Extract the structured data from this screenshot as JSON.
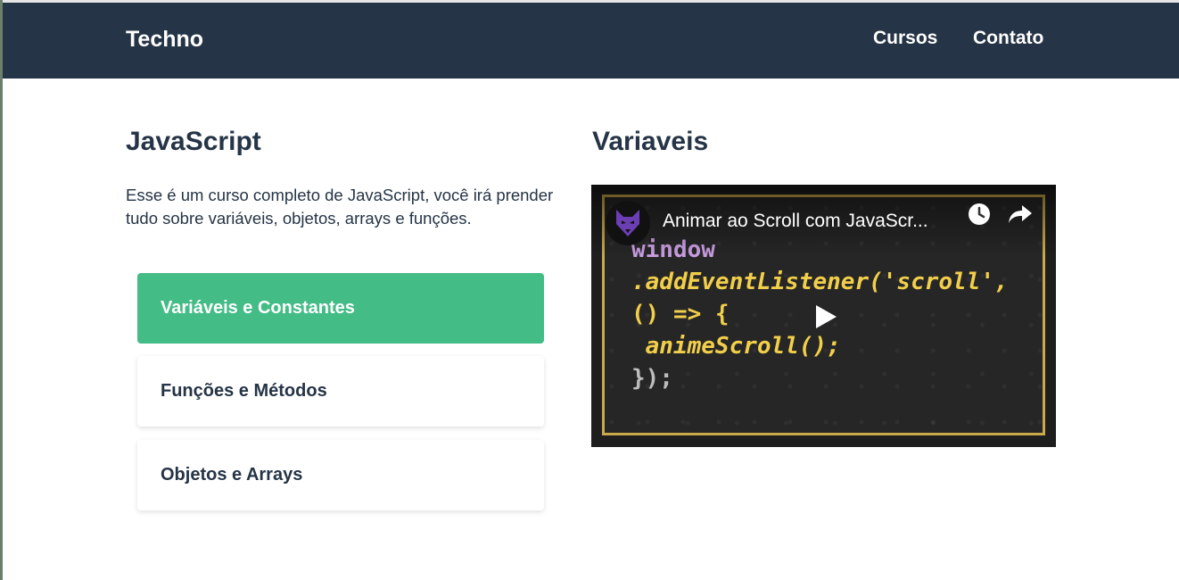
{
  "header": {
    "brand": "Techno",
    "nav": [
      "Cursos",
      "Contato"
    ]
  },
  "course": {
    "title": "JavaScript",
    "description": "Esse é um curso completo de JavaScript, você irá prender tudo sobre variáveis, objetos, arrays e funções.",
    "lessons": [
      {
        "label": "Variáveis e Constantes",
        "active": true
      },
      {
        "label": "Funções e Métodos",
        "active": false
      },
      {
        "label": "Objetos e Arrays",
        "active": false
      }
    ]
  },
  "lesson_view": {
    "title": "Variaveis",
    "video": {
      "title": "Animar ao Scroll com JavaScr...",
      "code_lines": [
        "window",
        ".addEventListener('scroll',",
        "() => {",
        " animeScroll();",
        "});"
      ]
    }
  },
  "colors": {
    "header_bg": "#253446",
    "active_lesson": "#43bc86",
    "text": "#253446",
    "video_border": "#c9a94a"
  },
  "icons": [
    "wolf-logo-icon",
    "clock-icon",
    "share-icon",
    "play-icon"
  ]
}
